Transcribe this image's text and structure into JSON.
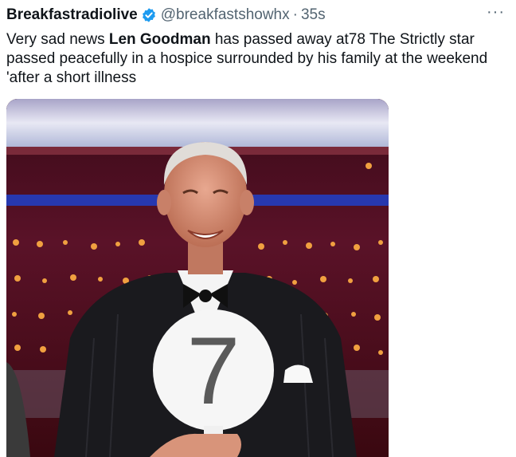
{
  "author": {
    "display_name": "Breakfastradiolive",
    "handle": "@breakfastshowhx",
    "separator": "·",
    "time": "35s",
    "verified_icon": "verified-badge-icon"
  },
  "more_button": {
    "label": "···",
    "icon": "more-options-icon"
  },
  "tweet": {
    "text_before": "Very sad news ",
    "text_bold": "Len Goodman",
    "text_after": " has passed away at78 The Strictly star passed peacefully in a hospice surrounded by his family at the weekend 'after a short illness"
  },
  "media": {
    "paddle_number": "7"
  },
  "colors": {
    "verified": "#1d9bf0",
    "muted": "#536471",
    "text": "#0f1419"
  }
}
